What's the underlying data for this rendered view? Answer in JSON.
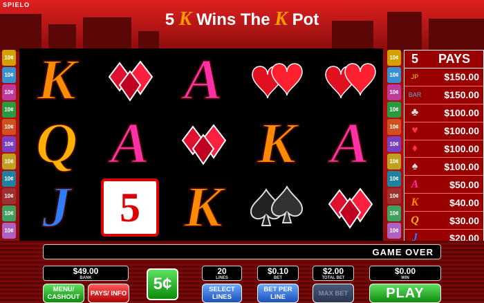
{
  "brand": "SPIELO",
  "title": {
    "pre": "5",
    "k1": "K",
    "mid": "Wins The",
    "k2": "K",
    "post": "Pot"
  },
  "line_marker_label": "10¢",
  "reels": [
    [
      "K",
      "Q",
      "J"
    ],
    [
      "diamonds",
      "A",
      "5"
    ],
    [
      "A",
      "diamonds",
      "K"
    ],
    [
      "hearts",
      "K",
      "spades"
    ],
    [
      "hearts",
      "A",
      "diamonds"
    ]
  ],
  "pays": {
    "count": "5",
    "title": "PAYS",
    "rows": [
      {
        "icon": "jackpot-icon",
        "value": "$150.00"
      },
      {
        "icon": "bar-icon",
        "value": "$150.00"
      },
      {
        "icon": "clubs-icon",
        "value": "$100.00"
      },
      {
        "icon": "hearts-icon",
        "value": "$100.00"
      },
      {
        "icon": "diamonds-icon",
        "value": "$100.00"
      },
      {
        "icon": "spades-icon",
        "value": "$100.00"
      },
      {
        "icon": "A",
        "value": "$50.00"
      },
      {
        "icon": "K",
        "value": "$40.00"
      },
      {
        "icon": "Q",
        "value": "$30.00"
      },
      {
        "icon": "J",
        "value": "$20.00"
      }
    ]
  },
  "status": "GAME OVER",
  "meters": {
    "bank": {
      "value": "$49.00",
      "label": "BANK"
    },
    "lines": {
      "value": "20",
      "label": "LINES"
    },
    "bet": {
      "value": "$0.10",
      "label": "BET"
    },
    "total_bet": {
      "value": "$2.00",
      "label": "TOTAL BET"
    },
    "win": {
      "value": "$0.00",
      "label": "WIN"
    }
  },
  "buttons": {
    "menu": "MENU/ CASHOUT",
    "pays": "PAYS/ INFO",
    "denom": "5¢",
    "select_lines": "SELECT LINES",
    "bet_per_line": "BET PER LINE",
    "max_bet": "MAX BET",
    "play": "PLAY"
  }
}
